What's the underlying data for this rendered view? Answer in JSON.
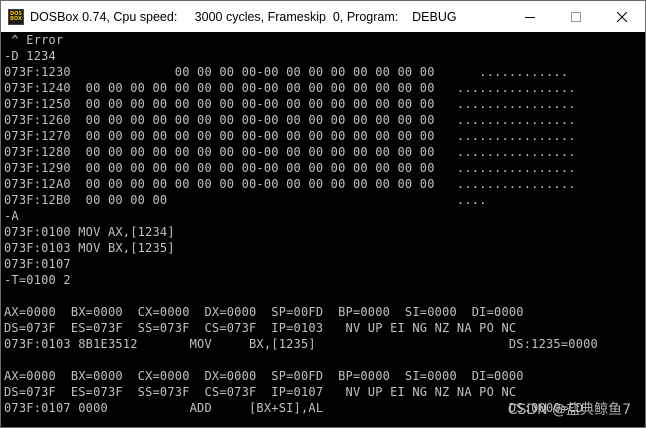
{
  "window": {
    "title": "DOSBox 0.74, Cpu speed:     3000 cycles, Frameskip  0, Program:    DEBUG",
    "icon_top": "DOS",
    "icon_bottom": "BOX",
    "minimize_icon": "minimize-icon",
    "maximize_icon": "maximize-icon",
    "close_icon": "close-icon"
  },
  "terminal": {
    "lines": [
      " ^ Error",
      "-D 1234",
      "073F:1230              00 00 00 00-00 00 00 00 00 00 00 00      ............",
      "073F:1240  00 00 00 00 00 00 00 00-00 00 00 00 00 00 00 00   ................",
      "073F:1250  00 00 00 00 00 00 00 00-00 00 00 00 00 00 00 00   ................",
      "073F:1260  00 00 00 00 00 00 00 00-00 00 00 00 00 00 00 00   ................",
      "073F:1270  00 00 00 00 00 00 00 00-00 00 00 00 00 00 00 00   ................",
      "073F:1280  00 00 00 00 00 00 00 00-00 00 00 00 00 00 00 00   ................",
      "073F:1290  00 00 00 00 00 00 00 00-00 00 00 00 00 00 00 00   ................",
      "073F:12A0  00 00 00 00 00 00 00 00-00 00 00 00 00 00 00 00   ................",
      "073F:12B0  00 00 00 00                                       ....",
      "-A",
      "073F:0100 MOV AX,[1234]",
      "073F:0103 MOV BX,[1235]",
      "073F:0107",
      "-T=0100 2",
      "",
      "AX=0000  BX=0000  CX=0000  DX=0000  SP=00FD  BP=0000  SI=0000  DI=0000",
      "DS=073F  ES=073F  SS=073F  CS=073F  IP=0103   NV UP EI NG NZ NA PO NC",
      "073F:0103 8B1E3512       MOV     BX,[1235]                          DS:1235=0000",
      "",
      "AX=0000  BX=0000  CX=0000  DX=0000  SP=00FD  BP=0000  SI=0000  DI=0000",
      "DS=073F  ES=073F  SS=073F  CS=073F  IP=0107   NV UP EI NG NZ NA PO NC",
      "073F:0107 0000           ADD     [BX+SI],AL                         DS:0000=CD"
    ]
  },
  "watermark": "CSDN @盐典鲸鱼7"
}
